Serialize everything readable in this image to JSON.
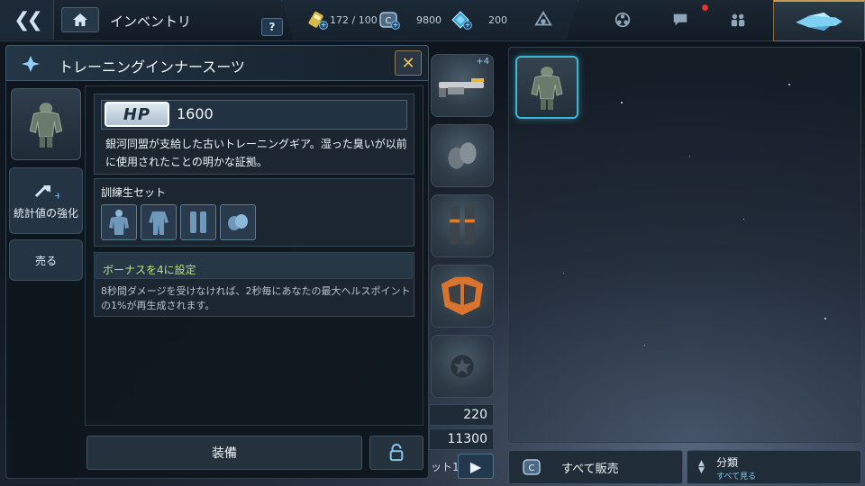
{
  "header": {
    "title": "インベントリ",
    "help_label": "?",
    "resources": [
      {
        "name": "energy",
        "icon": "battery-icon",
        "value": "172 / 100"
      },
      {
        "name": "credits",
        "icon": "credits-icon",
        "value": "9800"
      },
      {
        "name": "crystals",
        "icon": "crystal-icon",
        "value": "200"
      }
    ]
  },
  "item_panel": {
    "title": "トレーニングインナースーツ",
    "hp_label": "HP",
    "hp_value": "1600",
    "description": "銀河同盟が支給した古いトレーニングギア。湿った臭いが以前に使用されたことの明かな証拠。",
    "set_name": "訓練生セット",
    "bonus_title": "ボーナスを4に設定",
    "bonus_desc": "8秒間ダメージを受けなければ、2秒毎にあなたの最大ヘルスポイントの1%が再生成されます。",
    "equip_label": "装備"
  },
  "side_menu": {
    "upgrade_label": "統計値の強化",
    "sell_label": "売る"
  },
  "equipment": {
    "weapon_level": "+4",
    "stat1": "220",
    "stat2": "11300",
    "loadout_label": "ット1"
  },
  "inventory": {
    "sell_all_label": "すべて販売",
    "sort_label": "分類",
    "sort_sub": "すべて見る"
  },
  "colors": {
    "accent_cyan": "#3fb7d3",
    "bonus_green": "#b9e07b",
    "close_gold": "#e8bf62",
    "notification_red": "#e0342b"
  }
}
